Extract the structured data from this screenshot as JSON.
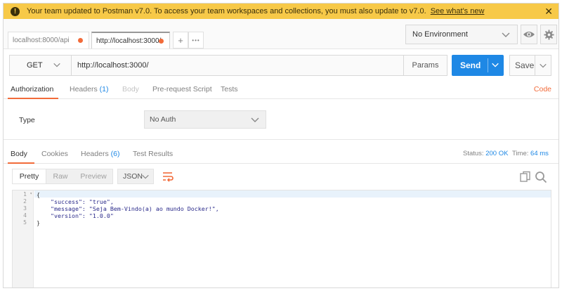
{
  "banner": {
    "message": "Your team updated to Postman v7.0. To access your team workspaces and collections, you must also update to v7.0.",
    "link": "See what's new",
    "close": "✕"
  },
  "tabs": [
    {
      "label": "localhost:8000/api",
      "active": false,
      "unsaved": true
    },
    {
      "label": "http://localhost:3000/",
      "active": true,
      "unsaved": true
    }
  ],
  "tab_add": "+",
  "tab_more": "•••",
  "environment": {
    "selected": "No Environment"
  },
  "request": {
    "method": "GET",
    "url": "http://localhost:3000/",
    "params": "Params",
    "send": "Send",
    "save": "Save"
  },
  "request_tabs": {
    "authorization": "Authorization",
    "headers": "Headers",
    "headers_count": "(1)",
    "body": "Body",
    "prerequest": "Pre-request Script",
    "tests": "Tests",
    "code": "Code"
  },
  "auth": {
    "type_label": "Type",
    "type_value": "No Auth"
  },
  "response_tabs": {
    "body": "Body",
    "cookies": "Cookies",
    "headers": "Headers",
    "headers_count": "(6)",
    "test_results": "Test Results"
  },
  "response_status": {
    "status_label": "Status:",
    "status_value": "200 OK",
    "time_label": "Time:",
    "time_value": "64 ms"
  },
  "response_view": {
    "pretty": "Pretty",
    "raw": "Raw",
    "preview": "Preview",
    "format": "JSON"
  },
  "response_body": {
    "line_numbers": [
      "1",
      "2",
      "3",
      "4",
      "5"
    ],
    "lines": [
      "{",
      "    \"success\": \"true\",",
      "    \"message\": \"Seja Bem-Vindo(a) ao mundo Docker!\",",
      "    \"version\": \"1.0.0\"",
      "}"
    ]
  },
  "colors": {
    "banner": "#f7c948",
    "accent": "#f26b3a",
    "primary": "#1e88e5"
  },
  "icons": [
    "warning-icon",
    "close-icon",
    "eye-icon",
    "gear-icon",
    "chevron-down-icon",
    "wrap-lines-icon",
    "copy-icon",
    "search-icon"
  ]
}
